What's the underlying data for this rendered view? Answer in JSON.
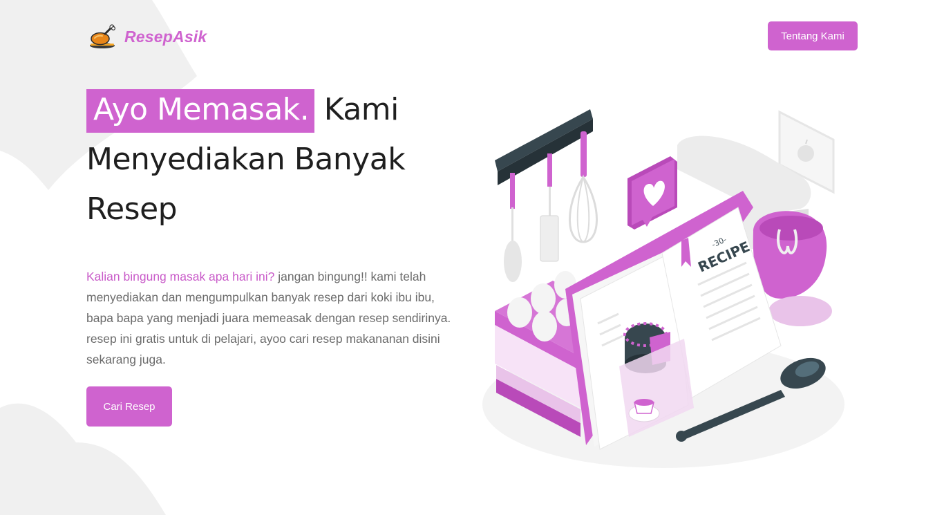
{
  "brand": {
    "name": "ResepAsik",
    "logo_icon": "roast-chicken-icon"
  },
  "nav": {
    "about_label": "Tentang Kami"
  },
  "hero": {
    "headline_highlight": "Ayo Memasak.",
    "headline_rest": " Kami Menyediakan Banyak Resep",
    "description_accent": "Kalian bingung masak apa hari ini?",
    "description_rest": " jangan bingung!! kami telah menyediakan dan mengumpulkan banyak resep dari koki ibu ibu, bapa bapa yang menjadi juara memeasak dengan resep sendirinya. resep ini gratis untuk di pelajari, ayoo cari resep makananan disini sekarang juga.",
    "cta_label": "Cari Resep"
  },
  "illustration": {
    "book_page_number": "-30-",
    "book_title": "RECIPE"
  },
  "colors": {
    "accent": "#cf63cf",
    "dark_slate": "#37474f",
    "bg_shape": "#f0f0f0"
  }
}
